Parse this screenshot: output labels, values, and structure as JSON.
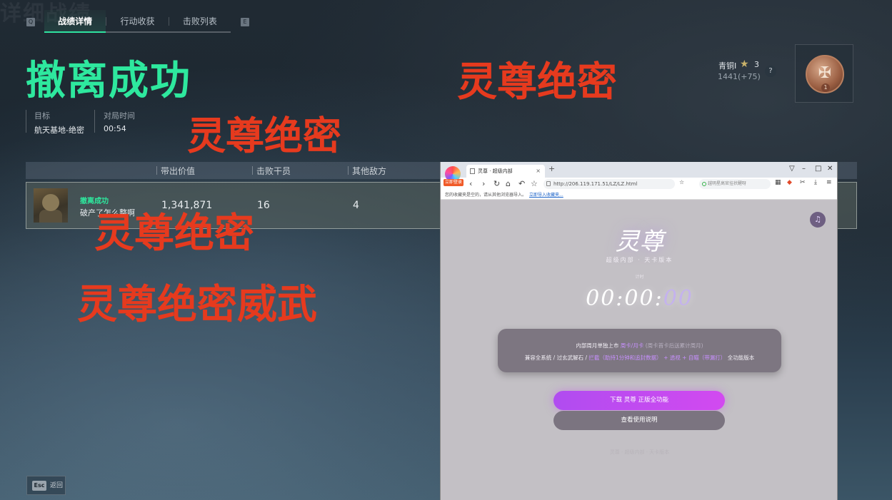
{
  "page": {
    "bg_title": "详细战绩"
  },
  "tabs": {
    "left_key": "Q",
    "right_key": "E",
    "items": [
      "战绩详情",
      "行动收获",
      "击败列表"
    ],
    "active_index": 0
  },
  "result": {
    "title": "撤离成功",
    "target_label": "目标",
    "target_value": "航天基地-绝密",
    "time_label": "对局时间",
    "time_value": "00:54"
  },
  "rank": {
    "name": "青铜I",
    "stars": "3",
    "score": "1441(+75)",
    "help": "?",
    "badge_level": "1"
  },
  "table": {
    "headers": [
      "带出价值",
      "击败干员",
      "其他敌方"
    ],
    "row": {
      "status": "撤离成功",
      "subtitle": "破产了怎么整啊",
      "value": "1,341,871",
      "kills": "16",
      "other": "4"
    }
  },
  "footer": {
    "esc_key": "Esc",
    "esc_label": "返回"
  },
  "watermarks": [
    "灵尊绝密",
    "灵尊绝密",
    "灵尊绝密",
    "灵尊绝密威武"
  ],
  "browser": {
    "logo_tag": "立即登录",
    "tab_title": "灵尊 · 超级内部",
    "tab_close": "×",
    "new_tab": "+",
    "url": "http://206.119.171.51/LZ/LZ.html",
    "search_placeholder": "越明星高官挂状醒呀",
    "favbar_text": "您的收藏夹是空的，请从其他浏览器导入。",
    "favbar_link": "立即导入收藏夹...",
    "page": {
      "music_icon": "♫",
      "brand": "灵尊",
      "brand_sub": "超级内部 · 天卡版本",
      "tiny_label": "计时",
      "timer_main": "00:00:",
      "timer_ms": "00",
      "info_line1_a": "内部周月单独上市",
      "info_line1_hl": "周卡/月卡",
      "info_line1_dim": "(周卡首卡后送累计周月)",
      "info_line2_a": "兼容全系统 / 过玄武解石 /",
      "info_line2_hl1": "拦截（助持1分钟和追封数据）",
      "info_line2_b": "+ 透视 + 自瞄（带漏打）",
      "info_line2_c": "全功能版本",
      "btn_download": "下载 灵尊 正版全功能",
      "btn_guide": "查看使用说明",
      "footer": "灵尊 · 超级内部 · 天卡版本"
    }
  }
}
